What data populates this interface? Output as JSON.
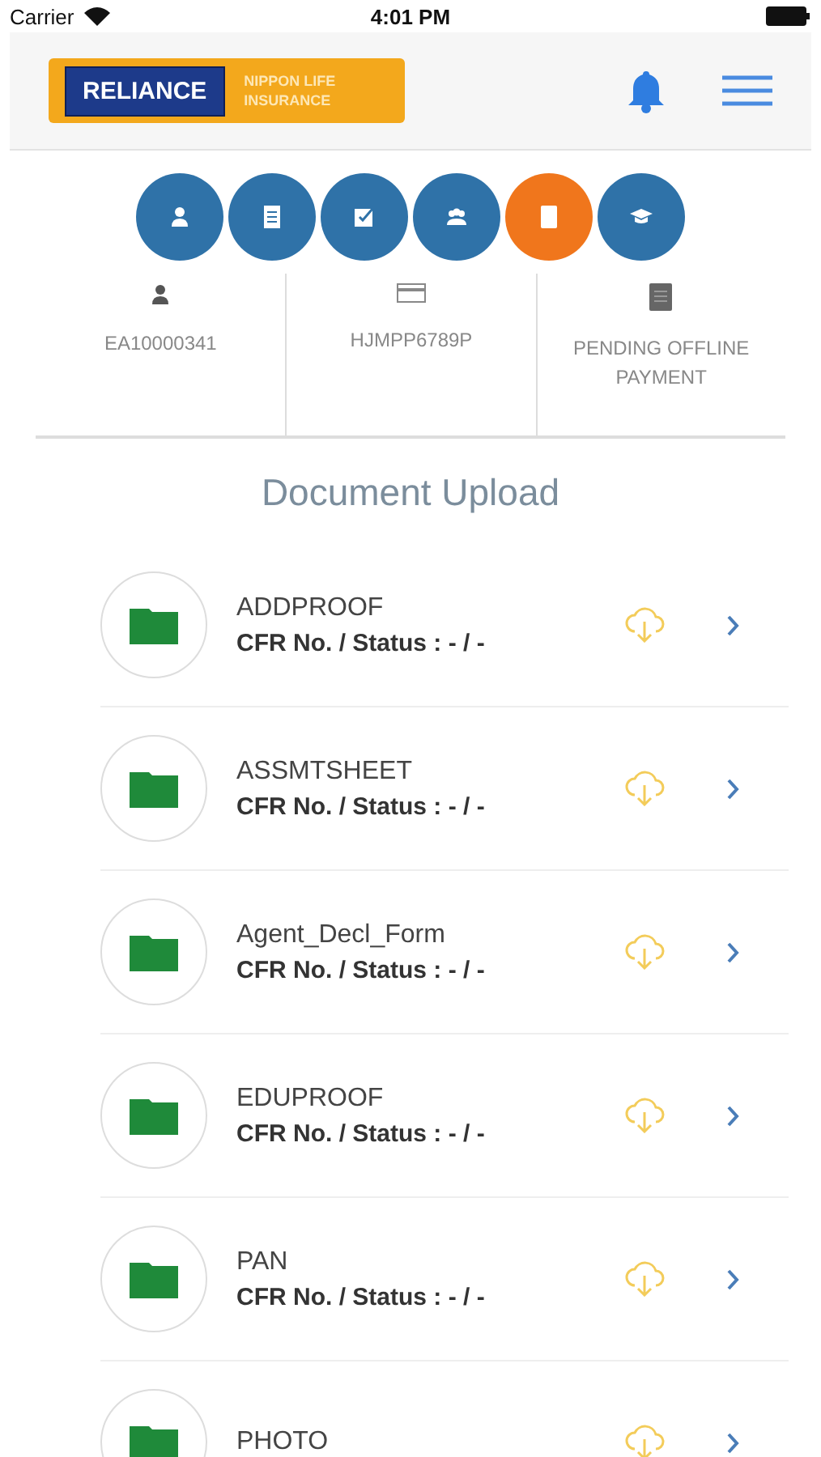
{
  "status_bar": {
    "carrier": "Carrier",
    "time": "4:01 PM"
  },
  "header": {
    "logo": {
      "brand": "RELIANCE",
      "line_1": "NIPPON LIFE",
      "line_2": "INSURANCE"
    }
  },
  "steps": [
    {
      "selected": false
    },
    {
      "selected": false
    },
    {
      "selected": false
    },
    {
      "selected": false
    },
    {
      "selected": true
    },
    {
      "selected": false
    }
  ],
  "info": [
    {
      "kind": "person",
      "text": "EA10000341"
    },
    {
      "kind": "card",
      "text": "HJMPP6789P"
    },
    {
      "kind": "document",
      "text": "PENDING OFFLINE PAYMENT"
    }
  ],
  "title": "Document Upload",
  "documents": [
    {
      "name": "ADDPROOF",
      "status": "CFR No. / Status : - / -"
    },
    {
      "name": "ASSMTSHEET",
      "status": "CFR No. / Status : - / -"
    },
    {
      "name": "Agent_Decl_Form",
      "status": "CFR No. / Status : - / -"
    },
    {
      "name": "EDUPROOF",
      "status": "CFR No. / Status : - / -"
    },
    {
      "name": "PAN",
      "status": "CFR No. / Status : - / -"
    },
    {
      "name": "PHOTO"
    }
  ]
}
